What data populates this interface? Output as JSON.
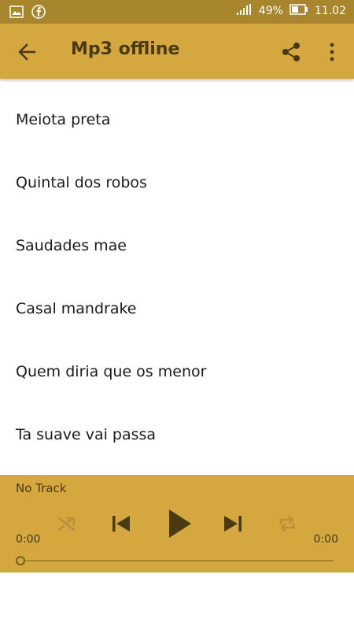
{
  "status": {
    "battery": "49%",
    "time": "11.02",
    "icons": [
      "image-icon",
      "facebook-icon",
      "signal-icon",
      "battery-icon"
    ]
  },
  "appbar": {
    "title": "Mp3 offline",
    "icons": [
      "back-arrow-icon",
      "share-icon",
      "more-vert-icon"
    ]
  },
  "tracks": [
    "Meiota preta",
    "Quintal dos robos",
    "Saudades mae",
    "Casal mandrake",
    "Quem diria que os menor",
    "Ta suave vai passa"
  ],
  "player": {
    "track_name": "No Track",
    "elapsed": "0:00",
    "duration": "0:00",
    "progress": 0,
    "controls": [
      "shuffle-icon",
      "previous-icon",
      "play-icon",
      "next-icon",
      "repeat-icon"
    ]
  },
  "colors": {
    "statusbar": "#a8862e",
    "accent": "#d4a73f",
    "icon_dark": "#4a3a12"
  }
}
